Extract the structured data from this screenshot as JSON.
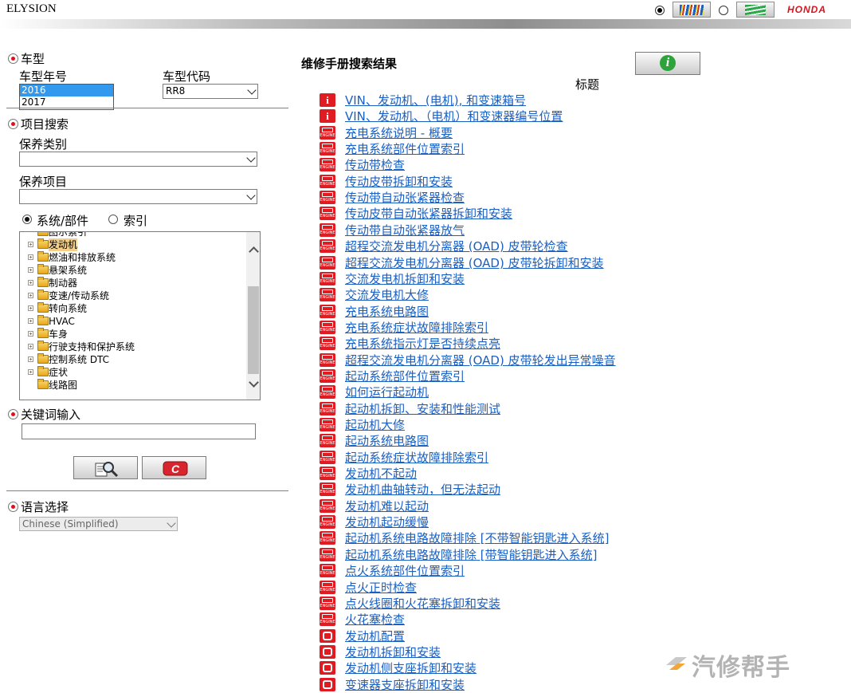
{
  "header": {
    "app_title": "ELYSION",
    "brand": "HONDA",
    "view_options": [
      {
        "name": "colored-books-view",
        "selected": true
      },
      {
        "name": "green-book-view",
        "selected": false
      }
    ]
  },
  "left_panel": {
    "vehicle": {
      "section_label": "车型",
      "year_label": "车型年号",
      "year_options": [
        "2016",
        "2017"
      ],
      "year_selected": "2016",
      "model_code_label": "车型代码",
      "model_code_value": "RR8"
    },
    "item_search": {
      "section_label": "项目搜索",
      "maintenance_category_label": "保养类别",
      "maintenance_category_value": "",
      "maintenance_item_label": "保养项目",
      "maintenance_item_value": "",
      "mode_system": "系统/部件",
      "mode_index": "索引",
      "mode_selected": "系统/部件",
      "tree": [
        {
          "label": "图示索引",
          "expandable": false,
          "active": false
        },
        {
          "label": "发动机",
          "expandable": true,
          "active": true
        },
        {
          "label": "燃油和排放系统",
          "expandable": true,
          "active": false
        },
        {
          "label": "悬架系统",
          "expandable": true,
          "active": false
        },
        {
          "label": "制动器",
          "expandable": true,
          "active": false
        },
        {
          "label": "变速/传动系统",
          "expandable": true,
          "active": false
        },
        {
          "label": "转向系统",
          "expandable": true,
          "active": false
        },
        {
          "label": "HVAC",
          "expandable": true,
          "active": false
        },
        {
          "label": "车身",
          "expandable": true,
          "active": false
        },
        {
          "label": "行驶支持和保护系统",
          "expandable": true,
          "active": false
        },
        {
          "label": "控制系统 DTC",
          "expandable": true,
          "active": false
        },
        {
          "label": "症状",
          "expandable": true,
          "active": false
        },
        {
          "label": "线路图",
          "expandable": false,
          "active": false
        }
      ]
    },
    "keyword": {
      "section_label": "关键词输入",
      "value": ""
    },
    "language": {
      "section_label": "语言选择",
      "value": "Chinese (Simplified)"
    }
  },
  "results": {
    "title": "维修手册搜索结果",
    "column_header": "标题",
    "items": [
      {
        "icon": "info",
        "label": "VIN、发动机、(电机), 和变速箱号"
      },
      {
        "icon": "info",
        "label": "VIN、发动机、（电机）和变速器编号位置"
      },
      {
        "icon": "engine",
        "label": "充电系统说明 - 概要"
      },
      {
        "icon": "engine",
        "label": "充电系统部件位置索引"
      },
      {
        "icon": "engine",
        "label": "传动带检查"
      },
      {
        "icon": "engine",
        "label": "传动皮带拆卸和安装"
      },
      {
        "icon": "engine",
        "label": "传动带自动张紧器检查"
      },
      {
        "icon": "engine",
        "label": "传动皮带自动张紧器拆卸和安装"
      },
      {
        "icon": "engine",
        "label": "传动带自动张紧器放气"
      },
      {
        "icon": "engine",
        "label": "超程交流发电机分离器 (OAD) 皮带轮检查"
      },
      {
        "icon": "engine",
        "label": "超程交流发电机分离器 (OAD) 皮带轮拆卸和安装"
      },
      {
        "icon": "engine",
        "label": "交流发电机拆卸和安装"
      },
      {
        "icon": "engine",
        "label": "交流发电机大修"
      },
      {
        "icon": "engine",
        "label": "充电系统电路图"
      },
      {
        "icon": "engine",
        "label": "充电系统症状故障排除索引"
      },
      {
        "icon": "engine",
        "label": "充电系统指示灯是否持续点亮"
      },
      {
        "icon": "engine",
        "label": "超程交流发电机分离器 (OAD) 皮带轮发出异常噪音"
      },
      {
        "icon": "engine",
        "label": "起动系统部件位置索引"
      },
      {
        "icon": "engine",
        "label": "如何运行起动机"
      },
      {
        "icon": "engine",
        "label": "起动机拆卸、安装和性能测试"
      },
      {
        "icon": "engine",
        "label": "起动机大修"
      },
      {
        "icon": "engine",
        "label": "起动系统电路图"
      },
      {
        "icon": "engine",
        "label": "起动系统症状故障排除索引"
      },
      {
        "icon": "engine",
        "label": "发动机不起动"
      },
      {
        "icon": "engine",
        "label": "发动机曲轴转动，但无法起动"
      },
      {
        "icon": "engine",
        "label": "发动机难以起动"
      },
      {
        "icon": "engine",
        "label": "发动机起动缓慢"
      },
      {
        "icon": "engine",
        "label": "起动机系统电路故障排除 [不带智能钥匙进入系统]"
      },
      {
        "icon": "engine",
        "label": "起动机系统电路故障排除 [带智能钥匙进入系统]"
      },
      {
        "icon": "engine",
        "label": "点火系统部件位置索引"
      },
      {
        "icon": "engine",
        "label": "点火正时检查"
      },
      {
        "icon": "engine",
        "label": "点火线圈和火花塞拆卸和安装"
      },
      {
        "icon": "engine",
        "label": "火花塞检查"
      },
      {
        "icon": "tool",
        "label": "发动机配置"
      },
      {
        "icon": "tool",
        "label": "发动机拆卸和安装"
      },
      {
        "icon": "tool",
        "label": "发动机侧支座拆卸和安装"
      },
      {
        "icon": "tool",
        "label": "变速器支座拆卸和安装"
      }
    ]
  },
  "watermark": "汽修帮手",
  "colors": {
    "accent_red": "#e01b22",
    "link_blue": "#1a5fc2",
    "selection_blue": "#3399ee"
  }
}
